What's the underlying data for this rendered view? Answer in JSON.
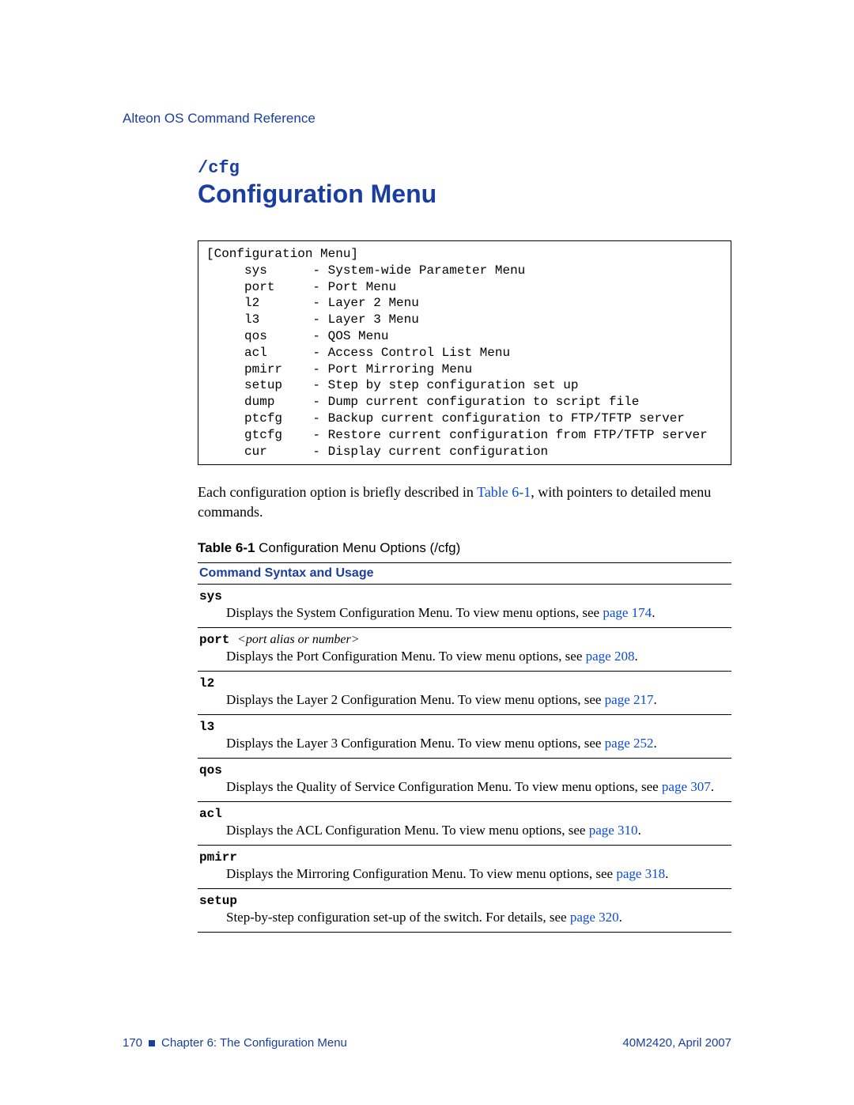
{
  "header": "Alteon OS Command Reference",
  "section_code": "/cfg",
  "section_title": "Configuration Menu",
  "menu_box": "[Configuration Menu]\n     sys      - System-wide Parameter Menu\n     port     - Port Menu\n     l2       - Layer 2 Menu\n     l3       - Layer 3 Menu\n     qos      - QOS Menu\n     acl      - Access Control List Menu\n     pmirr    - Port Mirroring Menu\n     setup    - Step by step configuration set up\n     dump     - Dump current configuration to script file\n     ptcfg    - Backup current configuration to FTP/TFTP server\n     gtcfg    - Restore current configuration from FTP/TFTP server\n     cur      - Display current configuration",
  "intro_pre": "Each configuration option is briefly described in ",
  "intro_link": "Table 6-1",
  "intro_post": ", with pointers to detailed menu commands.",
  "table_caption_bold": "Table 6-1 ",
  "table_caption_rest": "Configuration Menu Options (/cfg)",
  "table_header": "Command Syntax and Usage",
  "commands": {
    "sys": {
      "name": "sys",
      "param": "",
      "desc_pre": "Displays the System Configuration Menu. To view menu options, see ",
      "link": "page 174",
      "desc_post": "."
    },
    "port": {
      "name": "port ",
      "param": "<port alias or number>",
      "desc_pre": "Displays the Port Configuration Menu. To view menu options, see ",
      "link": "page 208",
      "desc_post": "."
    },
    "l2": {
      "name": "l2",
      "param": "",
      "desc_pre": "Displays the Layer 2 Configuration Menu. To view menu options, see ",
      "link": "page 217",
      "desc_post": "."
    },
    "l3": {
      "name": "l3",
      "param": "",
      "desc_pre": "Displays the Layer 3 Configuration Menu. To view menu options, see ",
      "link": "page 252",
      "desc_post": "."
    },
    "qos": {
      "name": "qos",
      "param": "",
      "desc_pre": "Displays the Quality of Service Configuration Menu. To view menu options, see ",
      "link": "page 307",
      "desc_post": "."
    },
    "acl": {
      "name": "acl",
      "param": "",
      "desc_pre": "Displays the ACL Configuration Menu. To view menu options, see ",
      "link": "page 310",
      "desc_post": "."
    },
    "pmirr": {
      "name": "pmirr",
      "param": "",
      "desc_pre": "Displays the Mirroring Configuration Menu. To view menu options, see ",
      "link": "page 318",
      "desc_post": "."
    },
    "setup": {
      "name": "setup",
      "param": "",
      "desc_pre": "Step-by-step configuration set-up of the switch. For details, see ",
      "link": "page 320",
      "desc_post": "."
    }
  },
  "footer": {
    "page_num": "170",
    "chapter": "Chapter 6:  The Configuration Menu",
    "docid": "40M2420, April 2007"
  }
}
